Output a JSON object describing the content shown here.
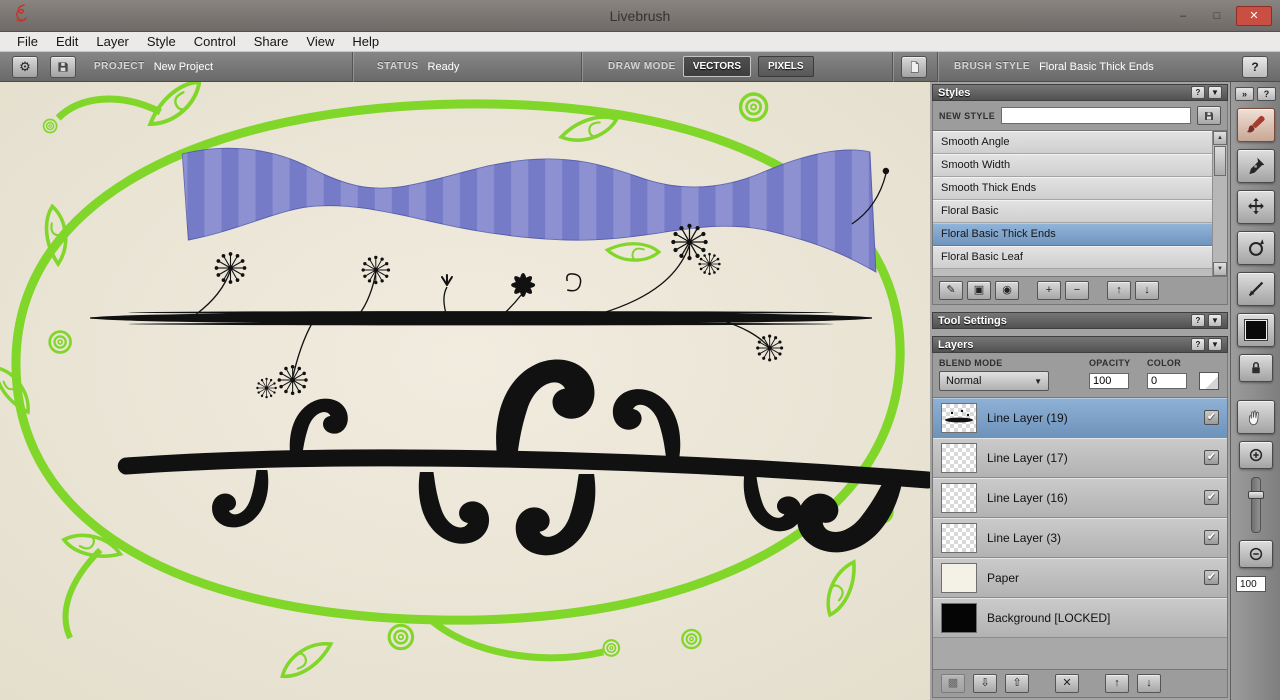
{
  "window": {
    "title": "Livebrush",
    "minimize_glyph": "–",
    "maximize_glyph": "□",
    "close_glyph": "✕"
  },
  "menu": {
    "items": [
      "File",
      "Edit",
      "Layer",
      "Style",
      "Control",
      "Share",
      "View",
      "Help"
    ]
  },
  "toolbar": {
    "project_label": "PROJECT",
    "project_value": "New Project",
    "status_label": "STATUS",
    "status_value": "Ready",
    "draw_mode_label": "DRAW MODE",
    "vectors_label": "VECTORS",
    "pixels_label": "PIXELS",
    "brush_style_label": "BRUSH STYLE",
    "brush_style_value": "Floral Basic Thick Ends",
    "help_label": "?"
  },
  "styles_panel": {
    "title": "Styles",
    "help_glyph": "?",
    "collapse_glyph": "▼",
    "new_style_label": "NEW STYLE",
    "new_style_value": "",
    "items": [
      {
        "label": "Smooth Angle",
        "selected": false
      },
      {
        "label": "Smooth Width",
        "selected": false
      },
      {
        "label": "Smooth Thick Ends",
        "selected": false
      },
      {
        "label": "Floral Basic",
        "selected": false
      },
      {
        "label": "Floral Basic Thick Ends",
        "selected": true
      },
      {
        "label": "Floral Basic Leaf",
        "selected": false
      }
    ],
    "scroll_up_glyph": "▲",
    "scroll_down_glyph": "▼",
    "buttons": [
      {
        "name": "rename-style",
        "glyph": "✎"
      },
      {
        "name": "save-style",
        "glyph": "▣"
      },
      {
        "name": "preview-style",
        "glyph": "◉"
      },
      {
        "name": "add-style",
        "glyph": "+"
      },
      {
        "name": "remove-style",
        "glyph": "−"
      },
      {
        "name": "move-style-up",
        "glyph": "↑"
      },
      {
        "name": "move-style-down",
        "glyph": "↓"
      }
    ]
  },
  "tool_settings_panel": {
    "title": "Tool Settings",
    "help_glyph": "?",
    "collapse_glyph": "▼"
  },
  "layers_panel": {
    "title": "Layers",
    "help_glyph": "?",
    "collapse_glyph": "▼",
    "blend_mode_label": "BLEND MODE",
    "blend_mode_value": "Normal",
    "dropdown_arrow": "▼",
    "opacity_label": "OPACITY",
    "opacity_value": "100",
    "color_label": "COLOR",
    "color_value": "0",
    "check_glyph": "✔",
    "layers": [
      {
        "name": "Line Layer (19)",
        "selected": true,
        "checked": true
      },
      {
        "name": "Line Layer (17)",
        "selected": false,
        "checked": true
      },
      {
        "name": "Line Layer (16)",
        "selected": false,
        "checked": true
      },
      {
        "name": "Line Layer (3)",
        "selected": false,
        "checked": true
      },
      {
        "name": "Paper",
        "selected": false,
        "checked": true
      },
      {
        "name": "Background [LOCKED]",
        "selected": false,
        "checked": false
      }
    ],
    "buttons": [
      {
        "name": "add-layer",
        "glyph": "▩"
      },
      {
        "name": "import-to-layer",
        "glyph": "⇩"
      },
      {
        "name": "export-layer",
        "glyph": "⇧"
      },
      {
        "name": "delete-layer",
        "glyph": "✕"
      },
      {
        "name": "move-layer-up",
        "glyph": "↑"
      },
      {
        "name": "move-layer-down",
        "glyph": "↓"
      }
    ]
  },
  "right_toolbar": {
    "overflow_glyph": "»",
    "help_glyph": "?",
    "zoom_value": "100"
  },
  "colors": {
    "selection_blue": "#7fa3cc",
    "vine_green": "#80d629",
    "ribbon_purple": "#767bc8",
    "close_red": "#c94f43"
  }
}
